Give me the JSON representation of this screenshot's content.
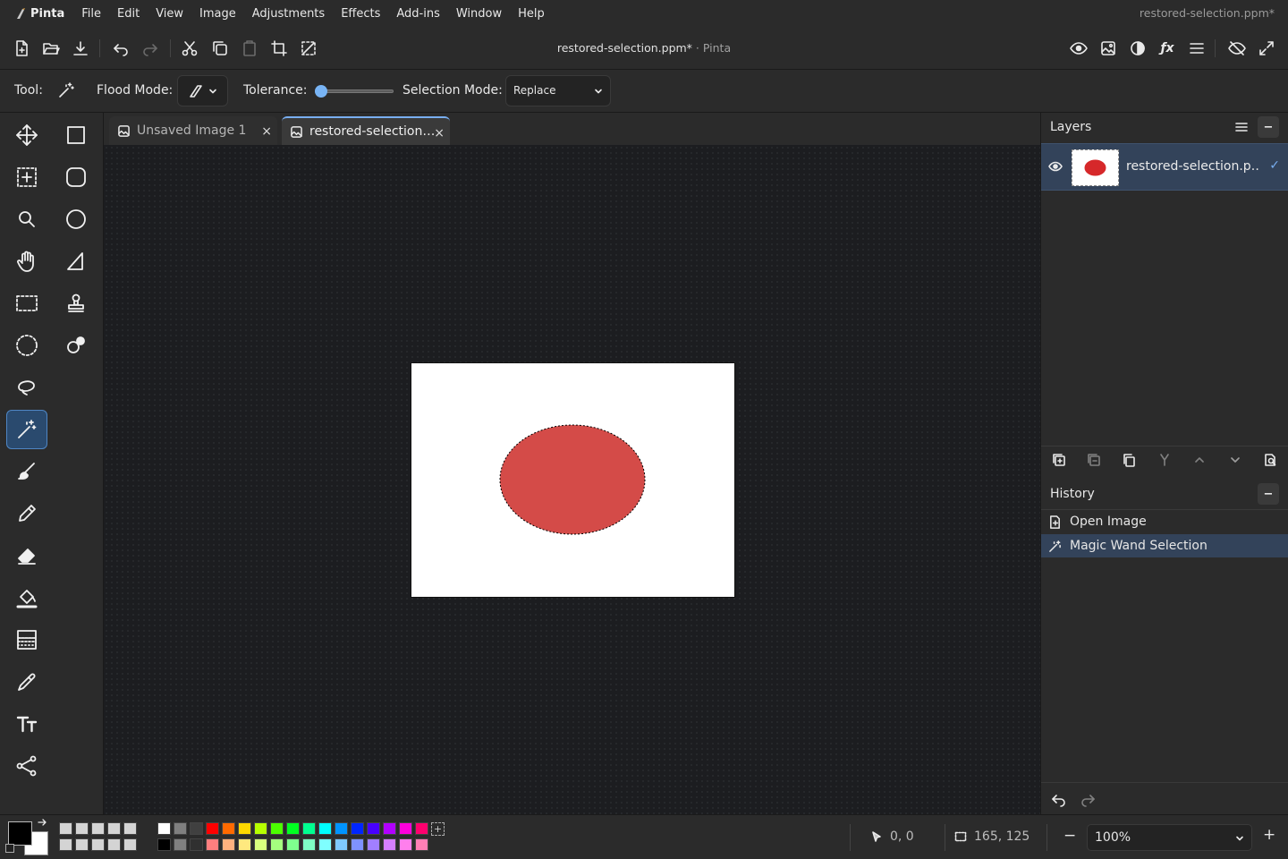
{
  "app": {
    "name": "Pinta",
    "window_title": "restored-selection.ppm*"
  },
  "menu": [
    "File",
    "Edit",
    "View",
    "Image",
    "Adjustments",
    "Effects",
    "Add-ins",
    "Window",
    "Help"
  ],
  "toolbar": {
    "doc_title": "restored-selection.ppm*",
    "doc_app": "Pinta",
    "left_icons": [
      "new-image-icon",
      "open-icon",
      "save-icon",
      "undo-icon",
      "redo-icon",
      "cut-icon",
      "copy-icon",
      "paste-icon",
      "crop-icon",
      "deselect-icon"
    ],
    "right_icons": [
      "view-icon",
      "image-icon",
      "adjustments-icon",
      "effects-icon",
      "menu-icon",
      "hide-icon",
      "fullscreen-icon"
    ]
  },
  "options": {
    "tool_label": "Tool:",
    "flood_mode_label": "Flood Mode:",
    "tolerance_label": "Tolerance:",
    "tolerance_value": 0,
    "selection_mode_label": "Selection Mode:",
    "selection_mode_value": "Replace"
  },
  "tools": [
    "move-selected",
    "rectangle",
    "move-selection",
    "rounded-rectangle",
    "zoom",
    "ellipse",
    "pan",
    "freeform-shape",
    "rectangle-select",
    "clone-stamp",
    "ellipse-select",
    "recolor",
    "lasso-select",
    "magic-wand",
    "paintbrush",
    "pencil",
    "eraser",
    "paint-bucket",
    "gradient",
    "color-picker",
    "text",
    "line-curve"
  ],
  "active_tool": "magic-wand",
  "tabs": [
    {
      "label": "Unsaved Image 1",
      "close": "×"
    },
    {
      "label": "restored-selection…",
      "close": "×"
    }
  ],
  "canvas": {
    "background": "#ffffff",
    "ellipse_color": "#d44b48"
  },
  "layers": {
    "title": "Layers",
    "items": [
      {
        "name": "restored-selection.p…",
        "visible": true,
        "checked": "✓"
      }
    ]
  },
  "history": {
    "title": "History",
    "items": [
      {
        "label": "Open Image",
        "icon": "open-image-icon"
      },
      {
        "label": "Magic Wand Selection",
        "icon": "magic-wand-icon",
        "selected": true
      }
    ]
  },
  "palette": {
    "primary": "#000000",
    "secondary": "#ffffff",
    "row1": [
      "#ffffff",
      "#808080",
      "#404040",
      "#ff0000",
      "#ff6a00",
      "#ffd800",
      "#b6ff00",
      "#4cff00",
      "#00ff21",
      "#00ff90",
      "#00ffff",
      "#0094ff",
      "#0026ff",
      "#4800ff",
      "#b200ff",
      "#ff00dc",
      "#ff006e"
    ],
    "row2": [
      "#000000",
      "#808080",
      "#303030",
      "#ff7f7f",
      "#ffb27f",
      "#ffe97f",
      "#daff7f",
      "#a5ff7f",
      "#7fff8e",
      "#7fffc5",
      "#7fffff",
      "#7fc9ff",
      "#7f92ff",
      "#a17fff",
      "#d67fff",
      "#ff7fed",
      "#ff7fb6"
    ]
  },
  "status": {
    "cursor_pos": "0, 0",
    "selection_size": "165, 125",
    "zoom": "100%",
    "zoom_out": "−",
    "zoom_in": "+"
  }
}
